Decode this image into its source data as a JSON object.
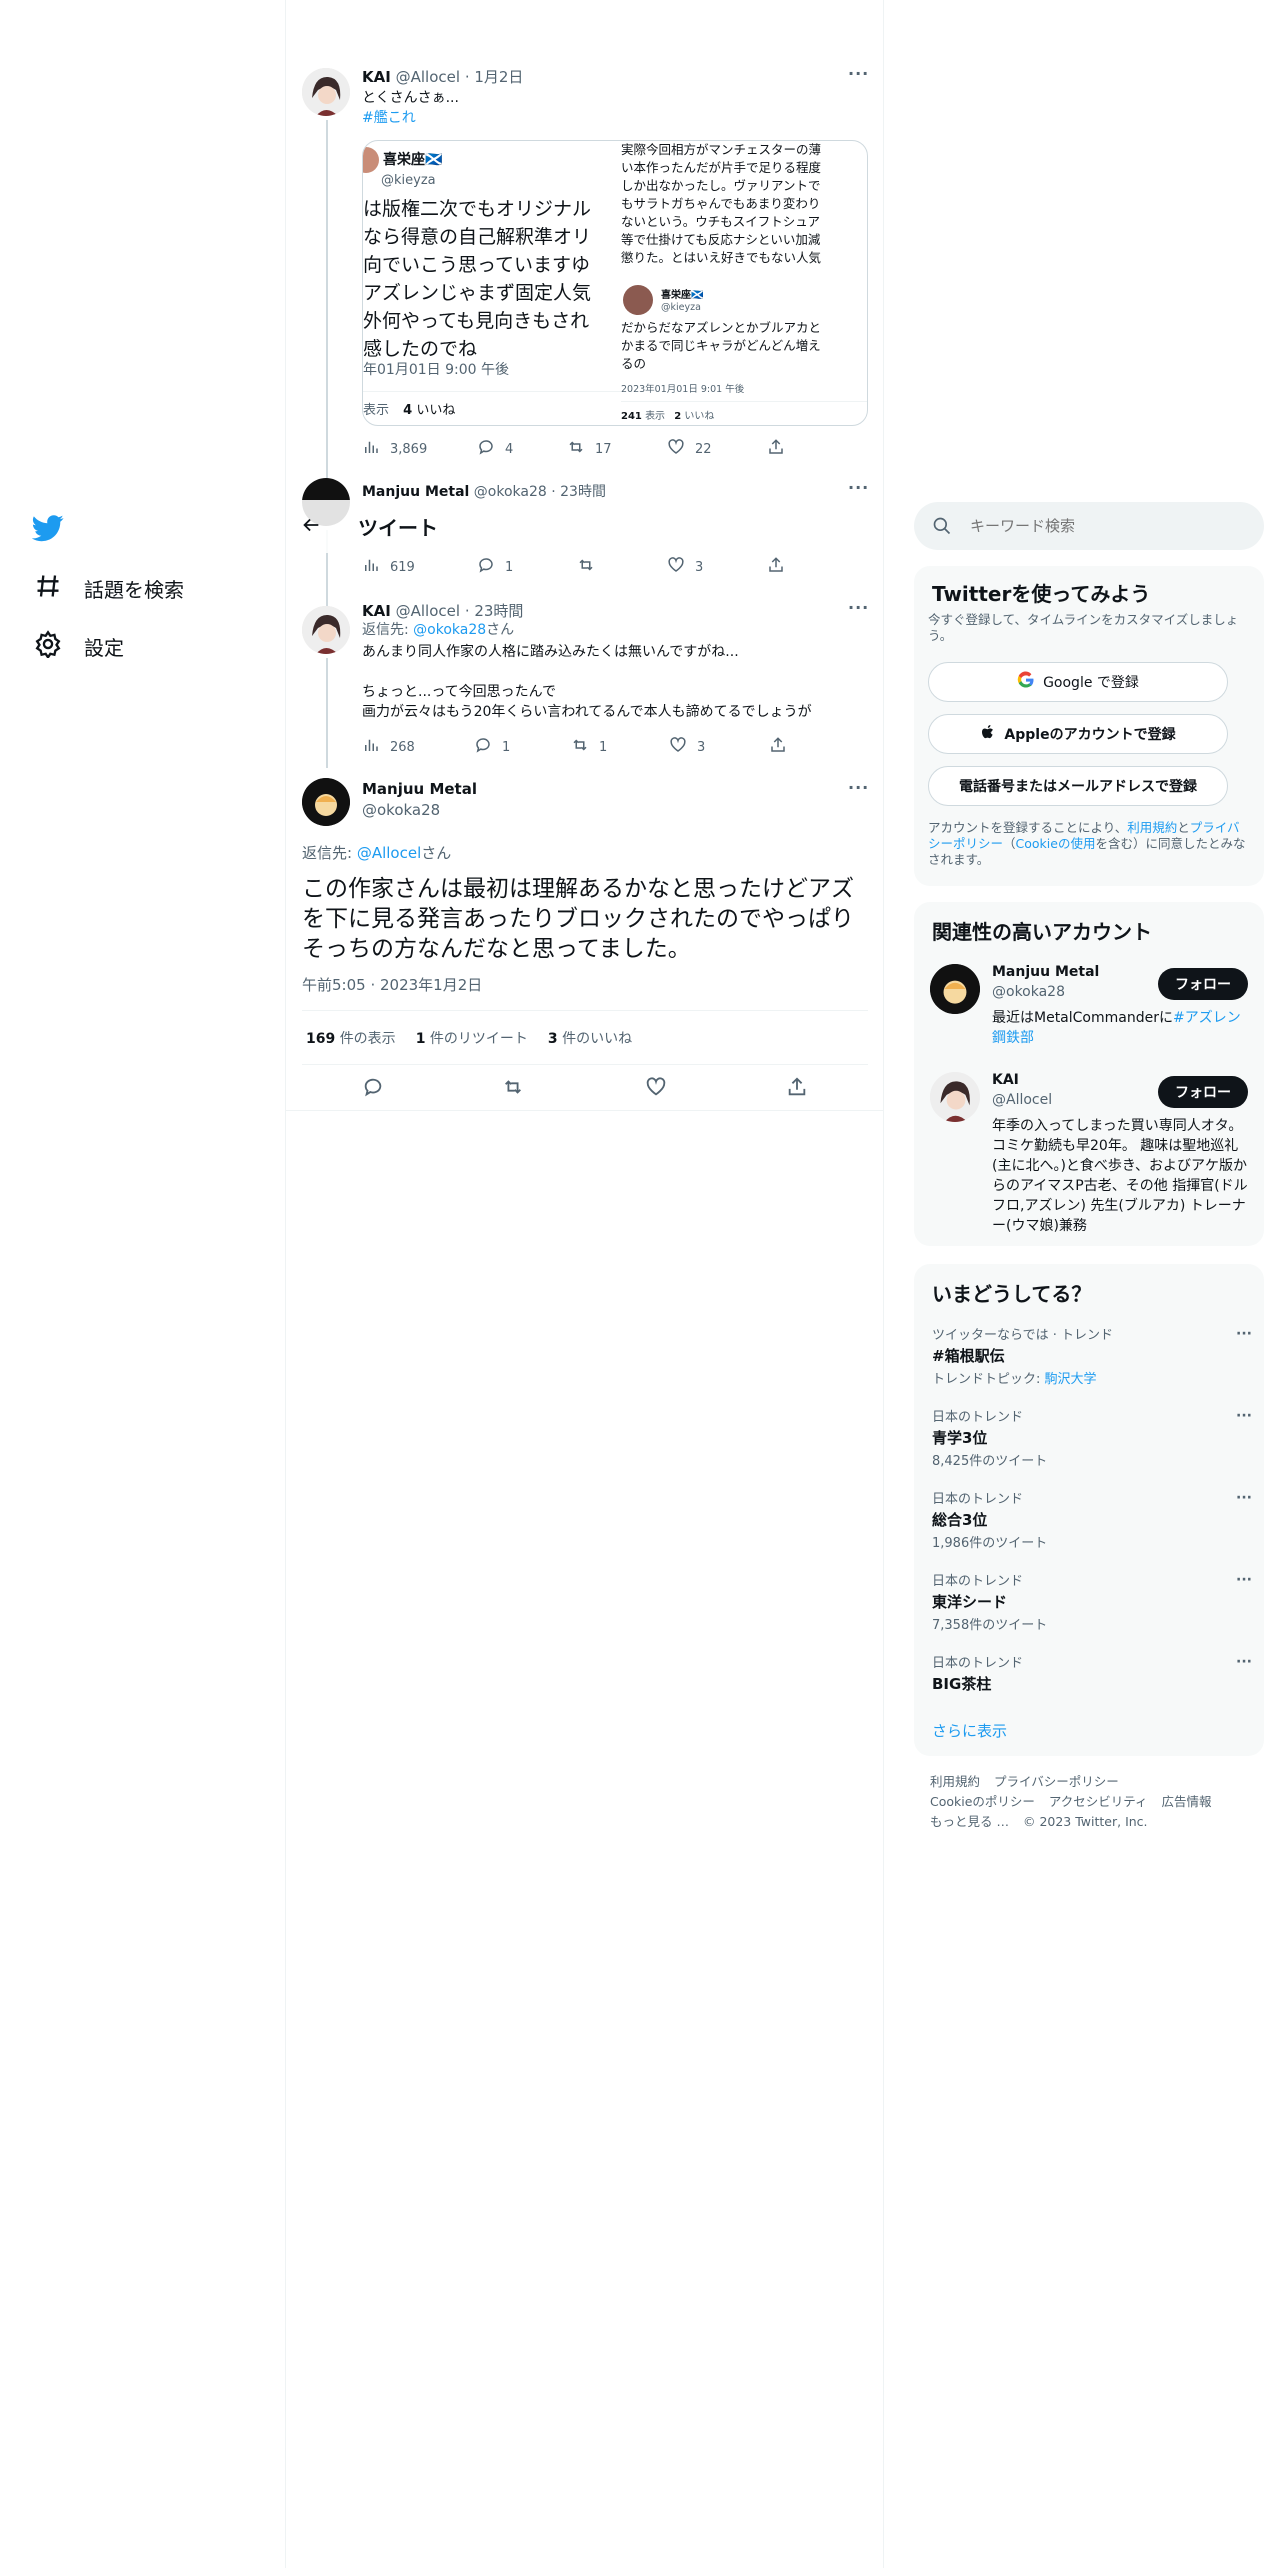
{
  "nav": {
    "explore": "話題を検索",
    "settings": "設定"
  },
  "header": {
    "title": "ツイート"
  },
  "tweet1": {
    "name": "KAI",
    "handle": "@Allocel",
    "time": "· 1月2日",
    "text": "とくさんさぁ...",
    "hashtag": "#艦これ",
    "img_left": {
      "name": "喜栄座🏴󠁧󠁢󠁳󠁣󠁴󠁿",
      "handle": "@kieyza",
      "lines": [
        "は版権二次でもオリジナル",
        "なら得意の自己解釈準オリ",
        "向でいこう思っていますゆ",
        "アズレンじゃまず固定人気",
        "外何やっても見向きもされ",
        "感したのでね"
      ],
      "date": "年01月01日 9:00 午後",
      "stats_prefix": "表示",
      "likes_num": "4",
      "likes_label": "いいね"
    },
    "img_right": {
      "lines": [
        "実際今回相方がマンチェスターの薄",
        "い本作ったんだが片手で足りる程度",
        "しか出なかったし。ヴァリアントで",
        "もサラトガちゃんでもあまり変わり",
        "ないという。ウチもスイフトシュア",
        "等で仕掛けても反応ナシといい加減",
        "懲りた。とはいえ好きでもない人気"
      ],
      "name": "喜栄座🏴󠁧󠁢󠁳󠁣󠁴󠁿",
      "handle": "@kieyza",
      "reply_lines": [
        "だからだなアズレンとかブルアカと",
        "かまるで同じキャラがどんどん増え",
        "るの"
      ],
      "date": "2023年01月01日 9:01 午後",
      "views_num": "241",
      "views_label": "表示",
      "likes_num": "2",
      "likes_label": "いいね"
    },
    "views": "3,869",
    "replies": "4",
    "retweets": "17",
    "likes": "22"
  },
  "tweet2": {
    "name": "Manjuu Metal",
    "handle": "@okoka28",
    "time": "· 23時間",
    "views": "619",
    "replies": "1",
    "retweets": "",
    "likes": "3"
  },
  "tweet3": {
    "name": "KAI",
    "handle": "@Allocel",
    "time": "· 23時間",
    "reply_prefix": "返信先: ",
    "reply_to": "@okoka28",
    "reply_suffix": "さん",
    "line1": "あんまり同人作家の人格に踏み込みたくは無いんですがね...",
    "line2": "ちょっと...って今回思ったんで",
    "line3": "画力が云々はもう20年くらい言われてるんで本人も諦めてるでしょうが",
    "views": "268",
    "replies": "1",
    "retweets": "1",
    "likes": "3"
  },
  "main_tweet": {
    "name": "Manjuu Metal",
    "handle": "@okoka28",
    "reply_prefix": "返信先: ",
    "reply_to": "@Allocel",
    "reply_suffix": "さん",
    "text": "この作家さんは最初は理解あるかなと思ったけどアズを下に見る発言あったりブロックされたのでやっぱりそっちの方なんだなと思ってました。",
    "timestamp": "午前5:05 · 2023年1月2日",
    "views_num": "169",
    "views_label": "件の表示",
    "rt_num": "1",
    "rt_label": "件のリツイート",
    "likes_num": "3",
    "likes_label": "件のいいね"
  },
  "search": {
    "placeholder": "キーワード検索"
  },
  "signup": {
    "title": "Twitterを使ってみよう",
    "subtitle": "今すぐ登録して、タイムラインをカスタマイズしましょう。",
    "google": "Google で登録",
    "apple": "Appleのアカウントで登録",
    "phone": "電話番号またはメールアドレスで登録",
    "legal_1": "アカウントを登録することにより、",
    "legal_terms": "利用規約",
    "legal_and": "と",
    "legal_privacy": "プライバシーポリシー",
    "legal_open": "（",
    "legal_cookie": "Cookieの使用",
    "legal_2": "を含む）に同意したとみなされます。"
  },
  "relevant": {
    "title": "関連性の高いアカウント",
    "follow": "フォロー",
    "accounts": [
      {
        "name": "Manjuu Metal",
        "handle": "@okoka28",
        "bio_text": "最近はMetalCommanderに",
        "bio_link": "#アズレン鋼鉄部"
      },
      {
        "name": "KAI",
        "handle": "@Allocel",
        "bio_text": "年季の入ってしまった買い専同人オタ。コミケ勤続も早20年。 趣味は聖地巡礼(主に北へ。)と食べ歩き、およびアケ版からのアイマスP古老、その他 指揮官(ドルフロ,アズレン) 先生(ブルアカ) トレーナー(ウマ娘)兼務"
      }
    ]
  },
  "trends": {
    "title": "いまどうしてる？",
    "items": [
      {
        "ctx": "ツイッターならでは · トレンド",
        "title": "#箱根駅伝",
        "sub_prefix": "トレンドトピック: ",
        "sub_link": "駒沢大学"
      },
      {
        "ctx": "日本のトレンド",
        "title": "青学3位",
        "count": "8,425件のツイート"
      },
      {
        "ctx": "日本のトレンド",
        "title": "総合3位",
        "count": "1,986件のツイート"
      },
      {
        "ctx": "日本のトレンド",
        "title": "東洋シード",
        "count": "7,358件のツイート"
      },
      {
        "ctx": "日本のトレンド",
        "title": "BIG茶柱",
        "count": ""
      }
    ],
    "show_more": "さらに表示"
  },
  "footer": {
    "terms": "利用規約",
    "privacy": "プライバシーポリシー",
    "cookie": "Cookieのポリシー",
    "accessibility": "アクセシビリティ",
    "ads": "広告情報",
    "more": "もっと見る …",
    "copyright": "© 2023 Twitter, Inc."
  },
  "colors": {
    "accent": "#1d9bf0",
    "text": "#0f1419",
    "muted": "#536471"
  }
}
